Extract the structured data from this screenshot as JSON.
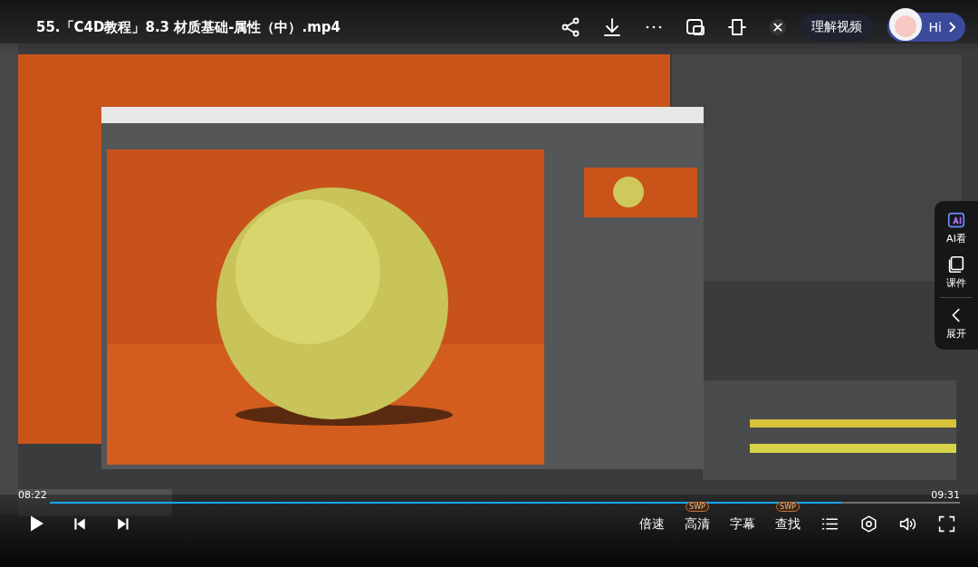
{
  "title": "55.「C4D教程」8.3 材质基础-属性（中）.mp4",
  "understand_button": "理解视频",
  "assistant": {
    "label": "Hi"
  },
  "side_panel": [
    {
      "kind": "ai",
      "label": "AI看"
    },
    {
      "kind": "courseware",
      "label": "课件"
    },
    {
      "kind": "expand",
      "label": "展开"
    }
  ],
  "player": {
    "current_time": "08:22",
    "duration": "09:31",
    "level": 0.87,
    "playing": false
  },
  "options": [
    {
      "label": "倍速"
    },
    {
      "label": "高清",
      "badge": "SWP"
    },
    {
      "label": "字幕"
    },
    {
      "label": "查找",
      "badge": "SWP"
    }
  ]
}
